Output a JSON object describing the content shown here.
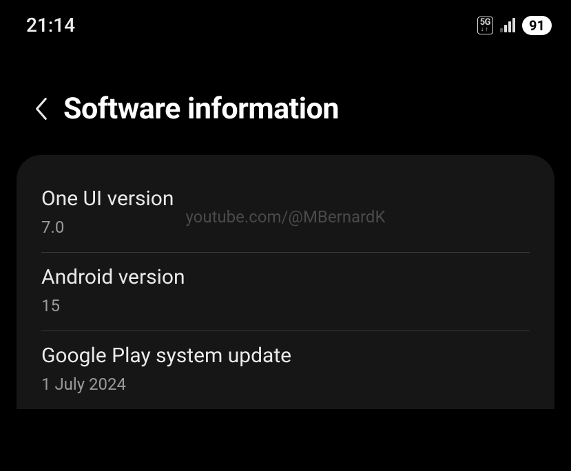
{
  "statusBar": {
    "time": "21:14",
    "network5G": "5G",
    "battery": "91"
  },
  "header": {
    "title": "Software information"
  },
  "watermark": "youtube.com/@MBernardK",
  "items": [
    {
      "title": "One UI version",
      "value": "7.0"
    },
    {
      "title": "Android version",
      "value": "15"
    },
    {
      "title": "Google Play system update",
      "value": "1 July 2024"
    }
  ]
}
